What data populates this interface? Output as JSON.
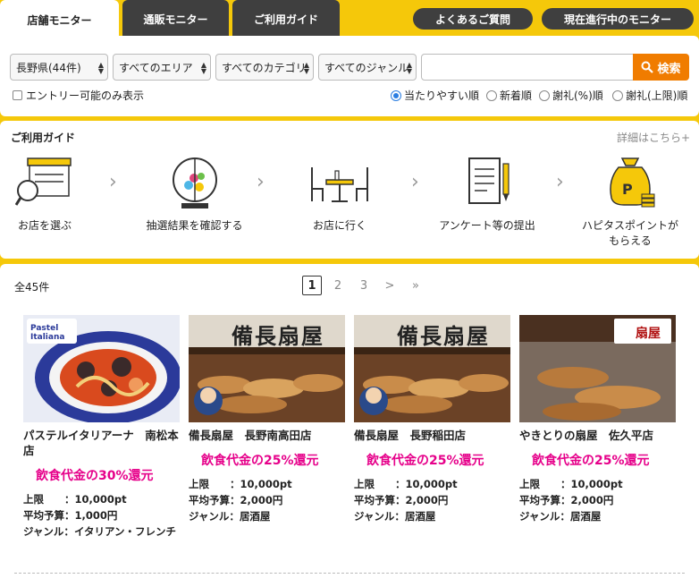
{
  "tabs": [
    {
      "label": "店舗モニター"
    },
    {
      "label": "通販モニター"
    },
    {
      "label": "ご利用ガイド"
    }
  ],
  "header_links": {
    "faq": "よくあるご質問",
    "current": "現在進行中のモニター"
  },
  "search": {
    "prefecture": "長野県(44件)",
    "area": "すべてのエリア",
    "category": "すべてのカテゴリ",
    "genre": "すべてのジャンル",
    "keyword_value": "",
    "button": "検索",
    "entry_only": "エントリー可能のみ表示",
    "sort_options": [
      "当たりやすい順",
      "新着順",
      "謝礼(%)順",
      "謝礼(上限)順"
    ]
  },
  "guide": {
    "title": "ご利用ガイド",
    "more": "詳細はこちら+",
    "steps": [
      {
        "label": "お店を選ぶ",
        "icon": "shop-search-icon"
      },
      {
        "label": "抽選結果を確認する",
        "icon": "lottery-icon"
      },
      {
        "label": "お店に行く",
        "icon": "table-chairs-icon"
      },
      {
        "label": "アンケート等の提出",
        "icon": "document-pen-icon"
      },
      {
        "label": "ハピタスポイントが",
        "label2": "もらえる",
        "icon": "money-bag-icon"
      }
    ]
  },
  "results": {
    "count": "全45件",
    "pages": [
      "1",
      "2",
      "3",
      ">",
      "»"
    ],
    "items": [
      {
        "name": "パステルイタリアーナ　南松本店",
        "reward": "飲食代金の30%還元",
        "limit_label": "上限　　：",
        "limit": "10,000pt",
        "budget_label": "平均予算：",
        "budget": "1,000円",
        "genre_label": "ジャンル：",
        "genre": "イタリアン・フレンチ",
        "logo": "Pastel Italiana"
      },
      {
        "name": "備長扇屋　長野南高田店",
        "reward": "飲食代金の25%還元",
        "limit_label": "上限　　：",
        "limit": "10,000pt",
        "budget_label": "平均予算：",
        "budget": "2,000円",
        "genre_label": "ジャンル：",
        "genre": "居酒屋",
        "logo": "備長扇屋"
      },
      {
        "name": "備長扇屋　長野稲田店",
        "reward": "飲食代金の25%還元",
        "limit_label": "上限　　：",
        "limit": "10,000pt",
        "budget_label": "平均予算：",
        "budget": "2,000円",
        "genre_label": "ジャンル：",
        "genre": "居酒屋",
        "logo": "備長扇屋"
      },
      {
        "name": "やきとりの扇屋　佐久平店",
        "reward": "飲食代金の25%還元",
        "limit_label": "上限　　：",
        "limit": "10,000pt",
        "budget_label": "平均予算：",
        "budget": "2,000円",
        "genre_label": "ジャンル：",
        "genre": "居酒屋",
        "logo": "扇屋"
      }
    ]
  },
  "colors": {
    "brand_yellow": "#f5c80a",
    "dark_tab": "#3f3f3f",
    "search_orange": "#f07c00",
    "reward_pink": "#e6008a"
  }
}
